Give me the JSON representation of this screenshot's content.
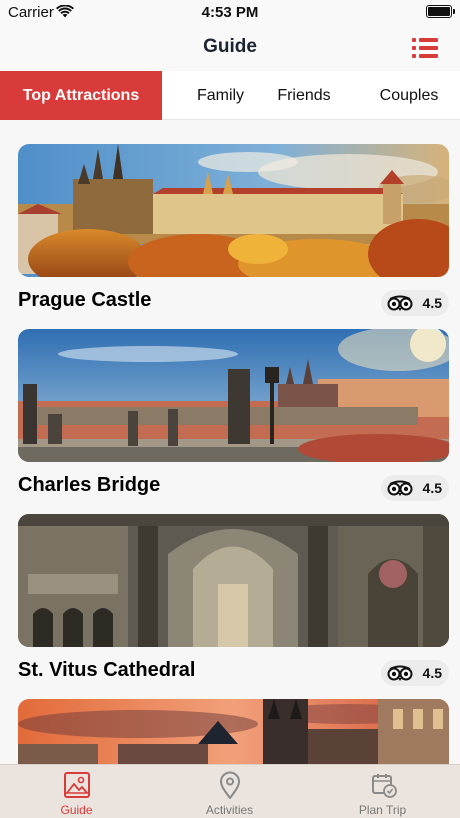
{
  "status_bar": {
    "carrier": "Carrier",
    "time": "4:53 PM"
  },
  "nav": {
    "title": "Guide"
  },
  "tabs": [
    {
      "label": "Top Attractions",
      "active": true
    },
    {
      "label": "Family",
      "active": false
    },
    {
      "label": "Friends",
      "active": false
    },
    {
      "label": "Couples",
      "active": false
    }
  ],
  "attractions": [
    {
      "name": "Prague Castle",
      "rating": "4.5"
    },
    {
      "name": "Charles Bridge",
      "rating": "4.5"
    },
    {
      "name": "St. Vitus Cathedral",
      "rating": "4.5"
    },
    {
      "name": "",
      "rating": ""
    }
  ],
  "tabbar": [
    {
      "label": "Guide",
      "icon": "image-icon",
      "active": true
    },
    {
      "label": "Activities",
      "icon": "map-pin-icon",
      "active": false
    },
    {
      "label": "Plan Trip",
      "icon": "planner-icon",
      "active": false
    }
  ],
  "colors": {
    "accent": "#d93a3a",
    "tabbar_bg": "#ebe3dd",
    "title": "#1c2333"
  }
}
